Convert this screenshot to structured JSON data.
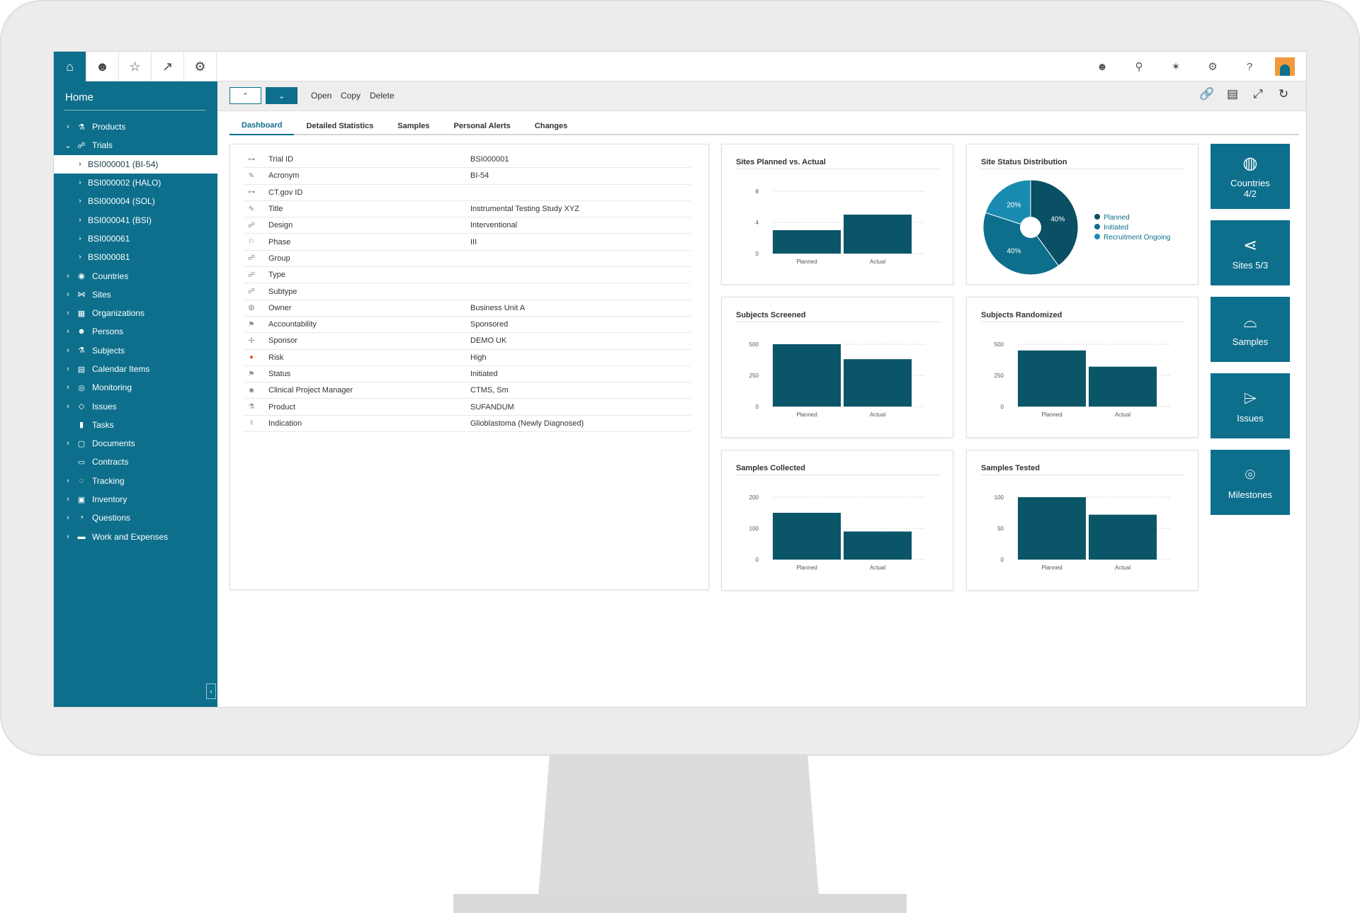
{
  "sidebar": {
    "home_title": "Home",
    "iconbar": [
      {
        "name": "home-icon",
        "glyph": "⌂"
      },
      {
        "name": "person-icon",
        "glyph": "☻"
      },
      {
        "name": "star-icon",
        "glyph": "☆"
      },
      {
        "name": "stats-icon",
        "glyph": "↗"
      },
      {
        "name": "settings-icon",
        "glyph": "⚙"
      }
    ],
    "items": [
      {
        "label": "Products",
        "icon": "⚗",
        "expanded": false
      },
      {
        "label": "Trials",
        "icon": "☍",
        "expanded": true
      },
      {
        "label": "BSI000001 (BI-54)",
        "child": true,
        "selected": true
      },
      {
        "label": "BSI000002 (HALO)",
        "child": true
      },
      {
        "label": "BSI000004 (SOL)",
        "child": true
      },
      {
        "label": "BSI000041 (BSI)",
        "child": true
      },
      {
        "label": "BSI000061",
        "child": true
      },
      {
        "label": "BSI000081",
        "child": true
      },
      {
        "label": "Countries",
        "icon": "◉"
      },
      {
        "label": "Sites",
        "icon": "⋈"
      },
      {
        "label": "Organizations",
        "icon": "▦"
      },
      {
        "label": "Persons",
        "icon": "☻"
      },
      {
        "label": "Subjects",
        "icon": "⚗"
      },
      {
        "label": "Calendar Items",
        "icon": "▤"
      },
      {
        "label": "Monitoring",
        "icon": "◎"
      },
      {
        "label": "Issues",
        "icon": "◇"
      },
      {
        "label": "Tasks",
        "icon": "▮",
        "noarrow": true
      },
      {
        "label": "Documents",
        "icon": "▢"
      },
      {
        "label": "Contracts",
        "icon": "▭",
        "noarrow": true
      },
      {
        "label": "Tracking",
        "icon": "◌"
      },
      {
        "label": "Inventory",
        "icon": "▣"
      },
      {
        "label": "Questions",
        "icon": "◔"
      },
      {
        "label": "Work and Expenses",
        "icon": "▬"
      }
    ],
    "collapse_glyph": "‹"
  },
  "topbar": {
    "icons": [
      {
        "name": "user-icon",
        "glyph": "☻"
      },
      {
        "name": "search-icon",
        "glyph": "⚲"
      },
      {
        "name": "magic-wand-icon",
        "glyph": "✶"
      },
      {
        "name": "gear-icon",
        "glyph": "⚙"
      },
      {
        "name": "help-icon",
        "glyph": "?"
      }
    ]
  },
  "toolbar": {
    "up_glyph": "⌃",
    "down_glyph": "⌄",
    "open_label": "Open",
    "copy_label": "Copy",
    "delete_label": "Delete",
    "right_icons": [
      {
        "name": "link-icon",
        "glyph": "🔗"
      },
      {
        "name": "document-icon",
        "glyph": "▤"
      },
      {
        "name": "fullscreen-icon",
        "glyph": "⤢"
      },
      {
        "name": "refresh-icon",
        "glyph": "↻"
      }
    ]
  },
  "tabs": [
    "Dashboard",
    "Detailed Statistics",
    "Samples",
    "Personal Alerts",
    "Changes"
  ],
  "info": [
    {
      "icon": "⊶",
      "label": "Trial ID",
      "value": "BSI000001"
    },
    {
      "icon": "✎",
      "label": "Acronym",
      "value": "BI-54"
    },
    {
      "icon": "⊶",
      "label": "CT.gov ID",
      "value": ""
    },
    {
      "icon": "✎",
      "label": "Title",
      "value": "Instrumental Testing Study XYZ"
    },
    {
      "icon": "☍",
      "label": "Design",
      "value": "Interventional"
    },
    {
      "icon": "⚐",
      "label": "Phase",
      "value": "III"
    },
    {
      "icon": "☍",
      "label": "Group",
      "value": ""
    },
    {
      "icon": "☍",
      "label": "Type",
      "value": ""
    },
    {
      "icon": "☍",
      "label": "Subtype",
      "value": ""
    },
    {
      "icon": "◍",
      "label": "Owner",
      "value": "Business Unit A"
    },
    {
      "icon": "⚑",
      "label": "Accountability",
      "value": "Sponsored"
    },
    {
      "icon": "✢",
      "label": "Sponsor",
      "value": "DEMO UK"
    },
    {
      "icon": "●",
      "label": "Risk",
      "value": "High",
      "icon_color": "#e0592a"
    },
    {
      "icon": "⚑",
      "label": "Status",
      "value": "Initiated"
    },
    {
      "icon": "☻",
      "label": "Clinical Project Manager",
      "value": "CTMS, Sm"
    },
    {
      "icon": "⚗",
      "label": "Product",
      "value": "SUFANDUM"
    },
    {
      "icon": "⚕",
      "label": "Indication",
      "value": "Glioblastoma (Newly Diagnosed)"
    }
  ],
  "colors": {
    "accent": "#0d6f8c",
    "bar": "#0a5568",
    "pie_dark": "#0a4f63",
    "pie_mid": "#0d6f8c",
    "pie_light": "#1a8bb0",
    "risk": "#e0592a"
  },
  "chart_data": [
    {
      "type": "bar",
      "title": "Sites Planned vs. Actual",
      "categories": [
        "Planned",
        "Actual"
      ],
      "values": [
        3,
        5
      ],
      "ylim": [
        0,
        8
      ],
      "yticks": [
        0,
        4,
        8
      ]
    },
    {
      "type": "pie",
      "title": "Site Status Distribution",
      "labels": [
        "Planned",
        "Initiated",
        "Recruitment Ongoing"
      ],
      "values": [
        40,
        40,
        20
      ],
      "legend": "right"
    },
    {
      "type": "bar",
      "title": "Subjects Screened",
      "categories": [
        "Planned",
        "Actual"
      ],
      "values": [
        500,
        380
      ],
      "ylim": [
        0,
        500
      ],
      "yticks": [
        0,
        250,
        500
      ]
    },
    {
      "type": "bar",
      "title": "Subjects Randomized",
      "categories": [
        "Planned",
        "Actual"
      ],
      "values": [
        450,
        320
      ],
      "ylim": [
        0,
        500
      ],
      "yticks": [
        0,
        250,
        500
      ]
    },
    {
      "type": "bar",
      "title": "Samples Collected",
      "categories": [
        "Planned",
        "Actual"
      ],
      "values": [
        150,
        90
      ],
      "ylim": [
        0,
        200
      ],
      "yticks": [
        0,
        100,
        200
      ]
    },
    {
      "type": "bar",
      "title": "Samples Tested",
      "categories": [
        "Planned",
        "Actual"
      ],
      "values": [
        100,
        72
      ],
      "ylim": [
        0,
        100
      ],
      "yticks": [
        0,
        50,
        100
      ]
    }
  ],
  "tiles": [
    {
      "name": "countries-tile",
      "icon": "countries-globe-icon",
      "glyph": "◍",
      "label": "Countries\n4/2"
    },
    {
      "name": "sites-tile",
      "icon": "share-nodes-icon",
      "glyph": "⋖",
      "label": "Sites 5/3"
    },
    {
      "name": "samples-tile",
      "icon": "shopping-bag-icon",
      "glyph": "⌓",
      "label": "Samples"
    },
    {
      "name": "issues-tile",
      "icon": "tag-icon",
      "glyph": "⌲",
      "label": "Issues"
    },
    {
      "name": "milestones-tile",
      "icon": "map-pin-icon",
      "glyph": "⌾",
      "label": "Milestones"
    }
  ]
}
